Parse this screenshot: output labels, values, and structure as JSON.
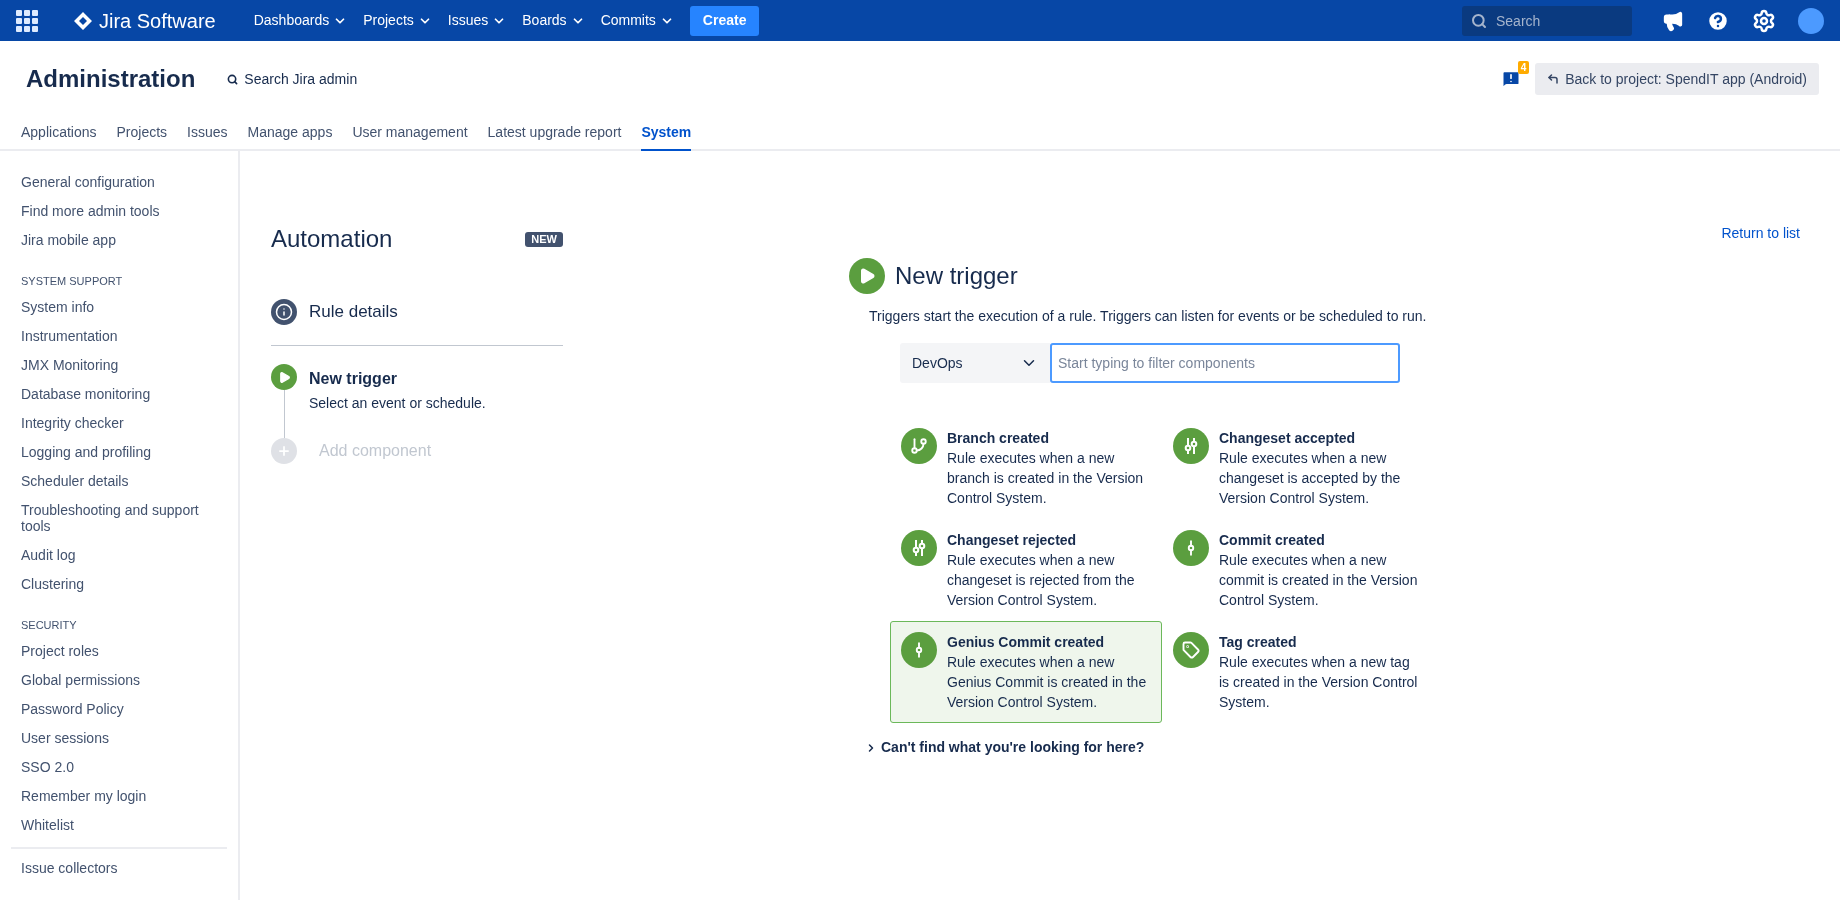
{
  "top_nav": {
    "product": "Jira Software",
    "menus": [
      {
        "label": "Dashboards"
      },
      {
        "label": "Projects"
      },
      {
        "label": "Issues"
      },
      {
        "label": "Boards"
      },
      {
        "label": "Commits"
      }
    ],
    "create": "Create",
    "search": {
      "placeholder": "Search"
    }
  },
  "header": {
    "title": "Administration",
    "search_link": "Search Jira admin",
    "notification_count": "4",
    "back_button": "Back to project: SpendIT app (Android)"
  },
  "tabs": [
    {
      "label": "Applications",
      "selected": false
    },
    {
      "label": "Projects",
      "selected": false
    },
    {
      "label": "Issues",
      "selected": false
    },
    {
      "label": "Manage apps",
      "selected": false
    },
    {
      "label": "User management",
      "selected": false
    },
    {
      "label": "Latest upgrade report",
      "selected": false
    },
    {
      "label": "System",
      "selected": true
    }
  ],
  "sidebar": {
    "sections": [
      {
        "items": [
          "General configuration",
          "Find more admin tools",
          "Jira mobile app"
        ]
      },
      {
        "heading": "SYSTEM SUPPORT",
        "items": [
          "System info",
          "Instrumentation",
          "JMX Monitoring",
          "Database monitoring",
          "Integrity checker",
          "Logging and profiling",
          "Scheduler details",
          "Troubleshooting and support tools",
          "Audit log",
          "Clustering"
        ]
      },
      {
        "heading": "SECURITY",
        "items": [
          "Project roles",
          "Global permissions",
          "Password Policy",
          "User sessions",
          "SSO 2.0",
          "Remember my login",
          "Whitelist"
        ]
      },
      {
        "divider": true,
        "items": [
          "Issue collectors"
        ]
      }
    ]
  },
  "automation": {
    "title": "Automation",
    "badge": "NEW",
    "steps": [
      {
        "kind": "info",
        "title": "Rule details"
      },
      {
        "kind": "trigger",
        "title": "New trigger",
        "subtitle": "Select an event or schedule."
      },
      {
        "kind": "add",
        "title": "Add component"
      }
    ]
  },
  "trigger_panel": {
    "return_link": "Return to list",
    "title": "New trigger",
    "description": "Triggers start the execution of a rule. Triggers can listen for events or be scheduled to run.",
    "category": "DevOps",
    "filter": {
      "placeholder": "Start typing to filter components"
    },
    "components": [
      {
        "kind": "branch",
        "title": "Branch created",
        "description": "Rule executes when a new branch is created in the Version Control System.",
        "selected": false
      },
      {
        "kind": "changeset",
        "title": "Changeset accepted",
        "description": "Rule executes when a new changeset is accepted by the Version Control System.",
        "selected": false
      },
      {
        "kind": "changeset",
        "title": "Changeset rejected",
        "description": "Rule executes when a new changeset is rejected from the Version Control System.",
        "selected": false
      },
      {
        "kind": "commit",
        "title": "Commit created",
        "description": "Rule executes when a new commit is created in the Version Control System.",
        "selected": false
      },
      {
        "kind": "commit",
        "title": "Genius Commit created",
        "description": "Rule executes when a new Genius Commit is created in the Version Control System.",
        "selected": true
      },
      {
        "kind": "tag",
        "title": "Tag created",
        "description": "Rule executes when a new tag is created in the Version Control System.",
        "selected": false
      }
    ],
    "help_toggle": "Can't find what you're looking for here?"
  }
}
